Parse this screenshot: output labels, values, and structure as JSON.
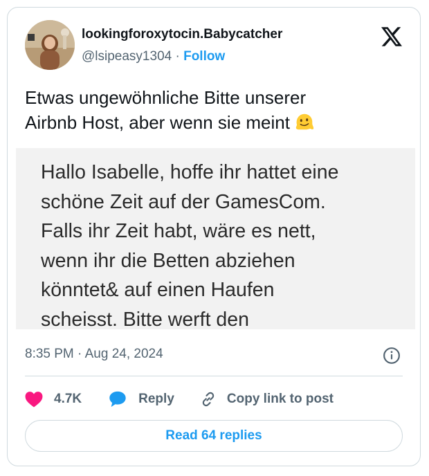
{
  "author": {
    "display_name": "lookingforoxytocin.Babycatcher",
    "handle": "@lsipeasy1304",
    "separator": "·",
    "follow_label": "Follow",
    "avatar_icon": "profile-photo"
  },
  "tweet": {
    "text_line1": "Etwas ungewöhnliche Bitte unserer",
    "text_line2": "Airbnb Host, aber wenn sie meint",
    "emoji": "melting-face-emoji"
  },
  "media": {
    "lines": [
      "Hallo Isabelle, hoffe ihr hattet eine",
      "schöne Zeit auf der GamesCom.",
      "Falls ihr Zeit habt, wäre es nett,",
      "wenn ihr die Betten abziehen",
      "könntet& auf einen Haufen",
      "scheisst. Bitte werft den"
    ]
  },
  "meta": {
    "time": "8:35 PM",
    "separator": "·",
    "date": "Aug 24, 2024"
  },
  "actions": {
    "like_count": "4.7K",
    "reply_label": "Reply",
    "copy_label": "Copy link to post"
  },
  "footer": {
    "read_replies_label": "Read 64 replies"
  },
  "colors": {
    "accent": "#1d9bf0",
    "like": "#f91880",
    "text": "#0f1419",
    "muted": "#536471",
    "border": "#cfd9de"
  }
}
